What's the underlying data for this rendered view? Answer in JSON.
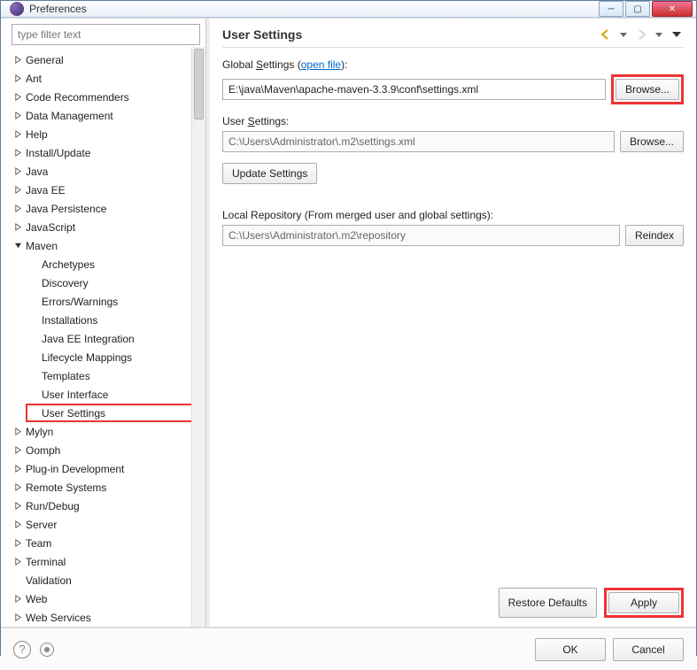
{
  "window": {
    "title": "Preferences"
  },
  "filter_placeholder": "type filter text",
  "tree": {
    "general": "General",
    "ant": "Ant",
    "code_rec": "Code Recommenders",
    "data_mgmt": "Data Management",
    "help": "Help",
    "install": "Install/Update",
    "java": "Java",
    "javaee": "Java EE",
    "jpa": "Java Persistence",
    "js": "JavaScript",
    "maven": "Maven",
    "maven_children": {
      "archetypes": "Archetypes",
      "discovery": "Discovery",
      "errors": "Errors/Warnings",
      "installations": "Installations",
      "javaee_int": "Java EE Integration",
      "lifecycle": "Lifecycle Mappings",
      "templates": "Templates",
      "ui": "User Interface",
      "user_settings": "User Settings"
    },
    "mylyn": "Mylyn",
    "oomph": "Oomph",
    "plugin_dev": "Plug-in Development",
    "remote": "Remote Systems",
    "run_debug": "Run/Debug",
    "server": "Server",
    "team": "Team",
    "terminal": "Terminal",
    "validation": "Validation",
    "web": "Web",
    "web_services": "Web Services"
  },
  "right": {
    "title": "User Settings",
    "global_label_prefix": "Global ",
    "global_label_u": "S",
    "global_label_rest": "ettings (",
    "open_file": "open file",
    "global_label_close": "):",
    "global_value": "E:\\java\\Maven\\apache-maven-3.3.9\\conf\\settings.xml",
    "browse": "Browse...",
    "user_label_prefix": "User ",
    "user_label_u": "S",
    "user_label_rest": "ettings:",
    "user_value": "C:\\Users\\Administrator\\.m2\\settings.xml",
    "update_settings": "Update Settings",
    "local_repo_label": "Local Repository (From merged user and global settings):",
    "local_repo_value": "C:\\Users\\Administrator\\.m2\\repository",
    "reindex": "Reindex",
    "restore_defaults": "Restore Defaults",
    "apply": "Apply"
  },
  "footer": {
    "ok": "OK",
    "cancel": "Cancel"
  }
}
